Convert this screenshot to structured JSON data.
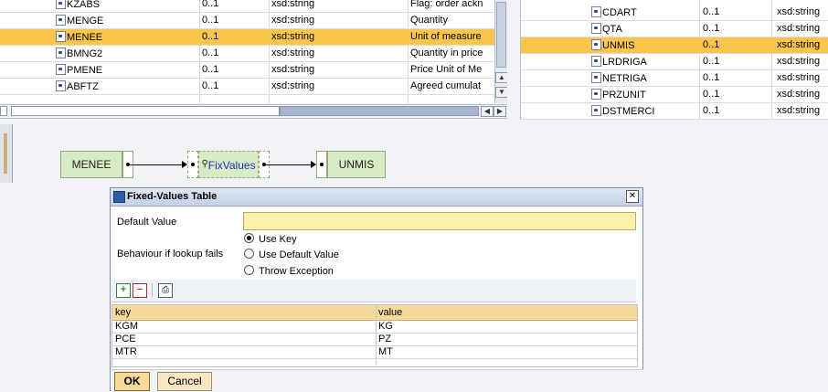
{
  "left_table": {
    "rows": [
      {
        "name": "KZABS",
        "occ": "0..1",
        "type": "xsd:string",
        "desc": "Flag: order ackn",
        "selected": false
      },
      {
        "name": "MENGE",
        "occ": "0..1",
        "type": "xsd:string",
        "desc": "Quantity",
        "selected": false
      },
      {
        "name": "MENEE",
        "occ": "0..1",
        "type": "xsd:string",
        "desc": "Unit of measure",
        "selected": true
      },
      {
        "name": "BMNG2",
        "occ": "0..1",
        "type": "xsd:string",
        "desc": "Quantity in price",
        "selected": false
      },
      {
        "name": "PMENE",
        "occ": "0..1",
        "type": "xsd:string",
        "desc": "Price Unit of Me",
        "selected": false
      },
      {
        "name": "ABFTZ",
        "occ": "0..1",
        "type": "xsd:string",
        "desc": "Agreed cumulat",
        "selected": false
      }
    ]
  },
  "right_table": {
    "rows": [
      {
        "name": "CDART",
        "occ": "0..1",
        "type": "xsd:string",
        "selected": false
      },
      {
        "name": "QTA",
        "occ": "0..1",
        "type": "xsd:string",
        "selected": false
      },
      {
        "name": "UNMIS",
        "occ": "0..1",
        "type": "xsd:string",
        "selected": true
      },
      {
        "name": "LRDRIGA",
        "occ": "0..1",
        "type": "xsd:string",
        "selected": false
      },
      {
        "name": "NETRIGA",
        "occ": "0..1",
        "type": "xsd:string",
        "selected": false
      },
      {
        "name": "PRZUNIT",
        "occ": "0..1",
        "type": "xsd:string",
        "selected": false
      },
      {
        "name": "DSTMERCI",
        "occ": "0..1",
        "type": "xsd:string",
        "selected": false
      }
    ]
  },
  "mapping": {
    "source": "MENEE",
    "function": "FixValues",
    "target": "UNMIS"
  },
  "dialog": {
    "title": "Fixed-Values Table",
    "default_value_label": "Default Value",
    "default_value": "",
    "behaviour_label": "Behaviour if lookup fails",
    "options": [
      {
        "label": "Use Key",
        "selected": true
      },
      {
        "label": "Use Default Value",
        "selected": false
      },
      {
        "label": "Throw Exception",
        "selected": false
      }
    ],
    "table": {
      "headers": [
        "key",
        "value"
      ],
      "rows": [
        [
          "KGM",
          "KG"
        ],
        [
          "PCE",
          "PZ"
        ],
        [
          "MTR",
          "MT"
        ]
      ]
    },
    "ok_label": "OK",
    "cancel_label": "Cancel"
  },
  "colors": {
    "selection": "#f9c54d",
    "block_fill": "#d7ebc5",
    "input_fill": "#fdf0a8"
  }
}
